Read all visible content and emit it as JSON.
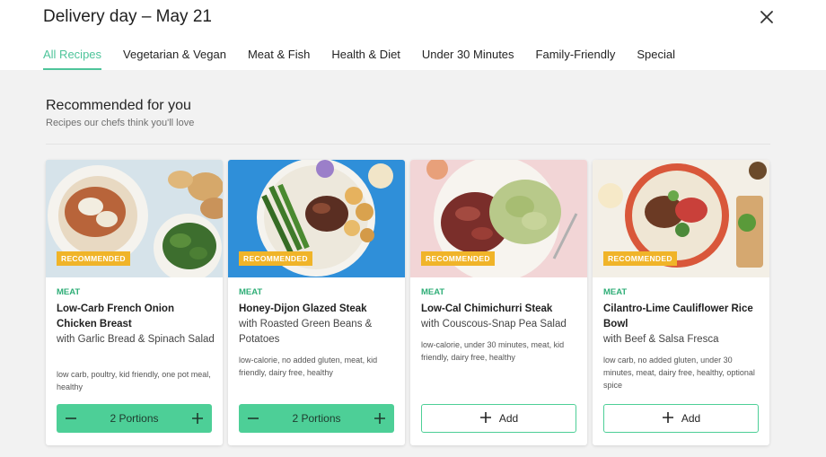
{
  "header": {
    "title": "Delivery day – May 21",
    "close_icon": "close-icon"
  },
  "tabs": [
    {
      "label": "All Recipes",
      "active": true
    },
    {
      "label": "Vegetarian & Vegan",
      "active": false
    },
    {
      "label": "Meat & Fish",
      "active": false
    },
    {
      "label": "Health & Diet",
      "active": false
    },
    {
      "label": "Under 30 Minutes",
      "active": false
    },
    {
      "label": "Family-Friendly",
      "active": false
    },
    {
      "label": "Special",
      "active": false
    }
  ],
  "section": {
    "title": "Recommended for you",
    "subtitle": "Recipes our chefs think you'll love"
  },
  "colors": {
    "accent": "#4ec49a",
    "badge": "#f0b429",
    "category": "#2fae77"
  },
  "cards": [
    {
      "badge": "RECOMMENDED",
      "category": "MEAT",
      "name": "Low-Carb French Onion Chicken Breast",
      "subtitle": "with Garlic Bread & Spinach Salad",
      "tags": "low carb, poultry, kid friendly, one pot meal, healthy",
      "action": "portions",
      "portions_label": "2 Portions",
      "minus_icon": "minus-icon",
      "plus_icon": "plus-icon"
    },
    {
      "badge": "RECOMMENDED",
      "category": "MEAT",
      "name": "Honey-Dijon Glazed Steak",
      "subtitle": "with Roasted Green Beans & Potatoes",
      "tags": "low-calorie, no added gluten, meat, kid friendly, dairy free, healthy",
      "action": "portions",
      "portions_label": "2 Portions",
      "minus_icon": "minus-icon",
      "plus_icon": "plus-icon"
    },
    {
      "badge": "RECOMMENDED",
      "category": "MEAT",
      "name": "Low-Cal Chimichurri Steak",
      "subtitle": "with Couscous-Snap Pea Salad",
      "tags": "low-calorie, under 30 minutes, meat, kid friendly, dairy free, healthy",
      "action": "add",
      "add_label": "Add",
      "plus_icon": "plus-icon"
    },
    {
      "badge": "RECOMMENDED",
      "category": "MEAT",
      "name": "Cilantro-Lime Cauliflower Rice Bowl",
      "subtitle": "with Beef & Salsa Fresca",
      "tags": "low carb, no added gluten, under 30 minutes, meat, dairy free, healthy, optional spice",
      "action": "add",
      "add_label": "Add",
      "plus_icon": "plus-icon"
    }
  ]
}
